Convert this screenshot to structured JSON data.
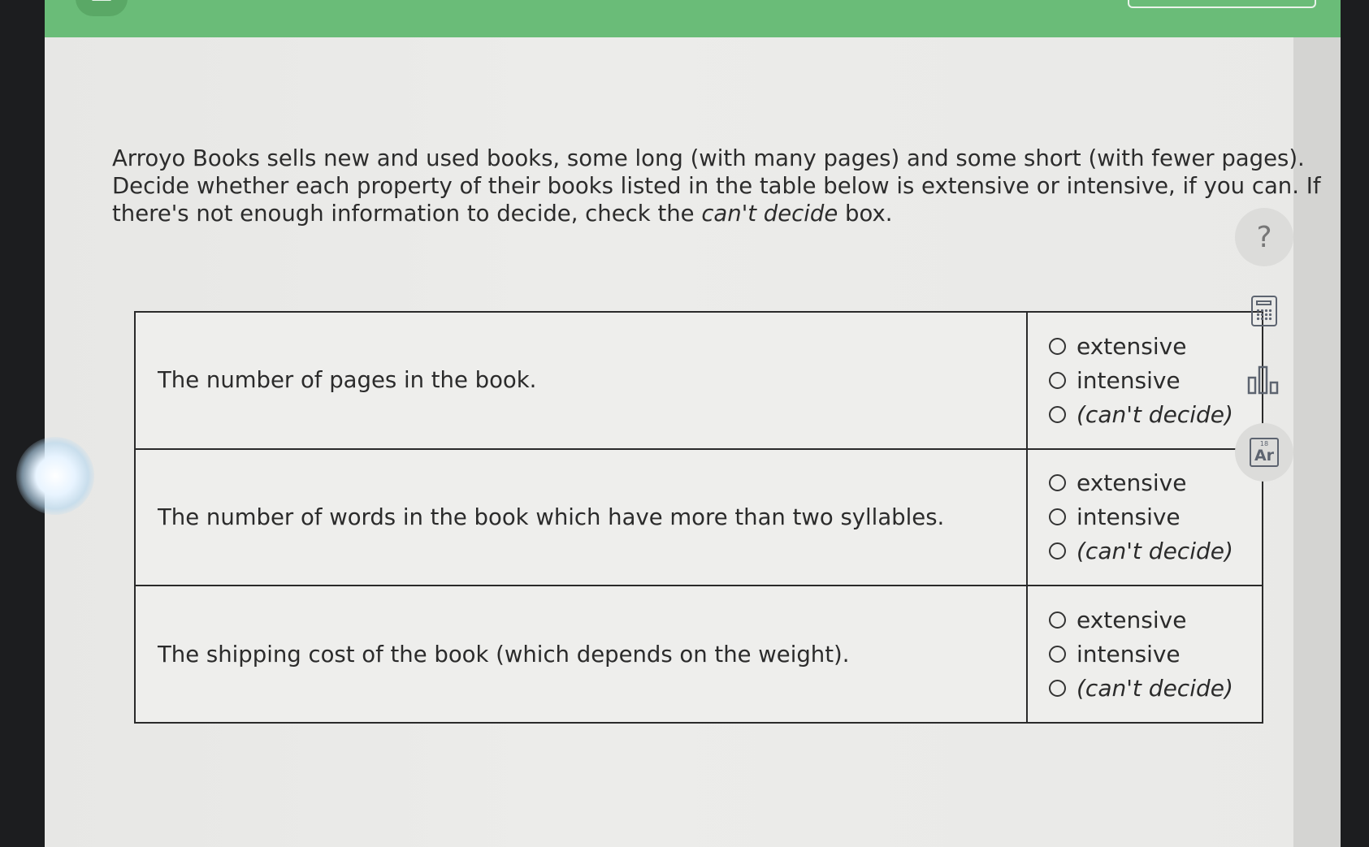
{
  "question": {
    "text_before": "Arroyo Books sells new and used books, some long (with many pages) and some short (with fewer pages). Decide whether each property of their books listed in the table below is extensive or intensive, if you can. If there's not enough information to decide, check the ",
    "text_emphasis": "can't decide",
    "text_after": " box."
  },
  "options": {
    "extensive": "extensive",
    "intensive": "intensive",
    "cant_decide": "(can't decide)"
  },
  "rows": [
    {
      "property": "The number of pages in the book."
    },
    {
      "property": "The number of words in the book which have more than two syllables."
    },
    {
      "property": "The shipping cost of the book (which depends on the weight)."
    }
  ],
  "tools": {
    "help_glyph": "?",
    "periodic_number": "18",
    "periodic_symbol": "Ar"
  },
  "colors": {
    "topbar": "#6abc78",
    "table_border": "#2a2a2a",
    "icon": "#5d6470"
  }
}
